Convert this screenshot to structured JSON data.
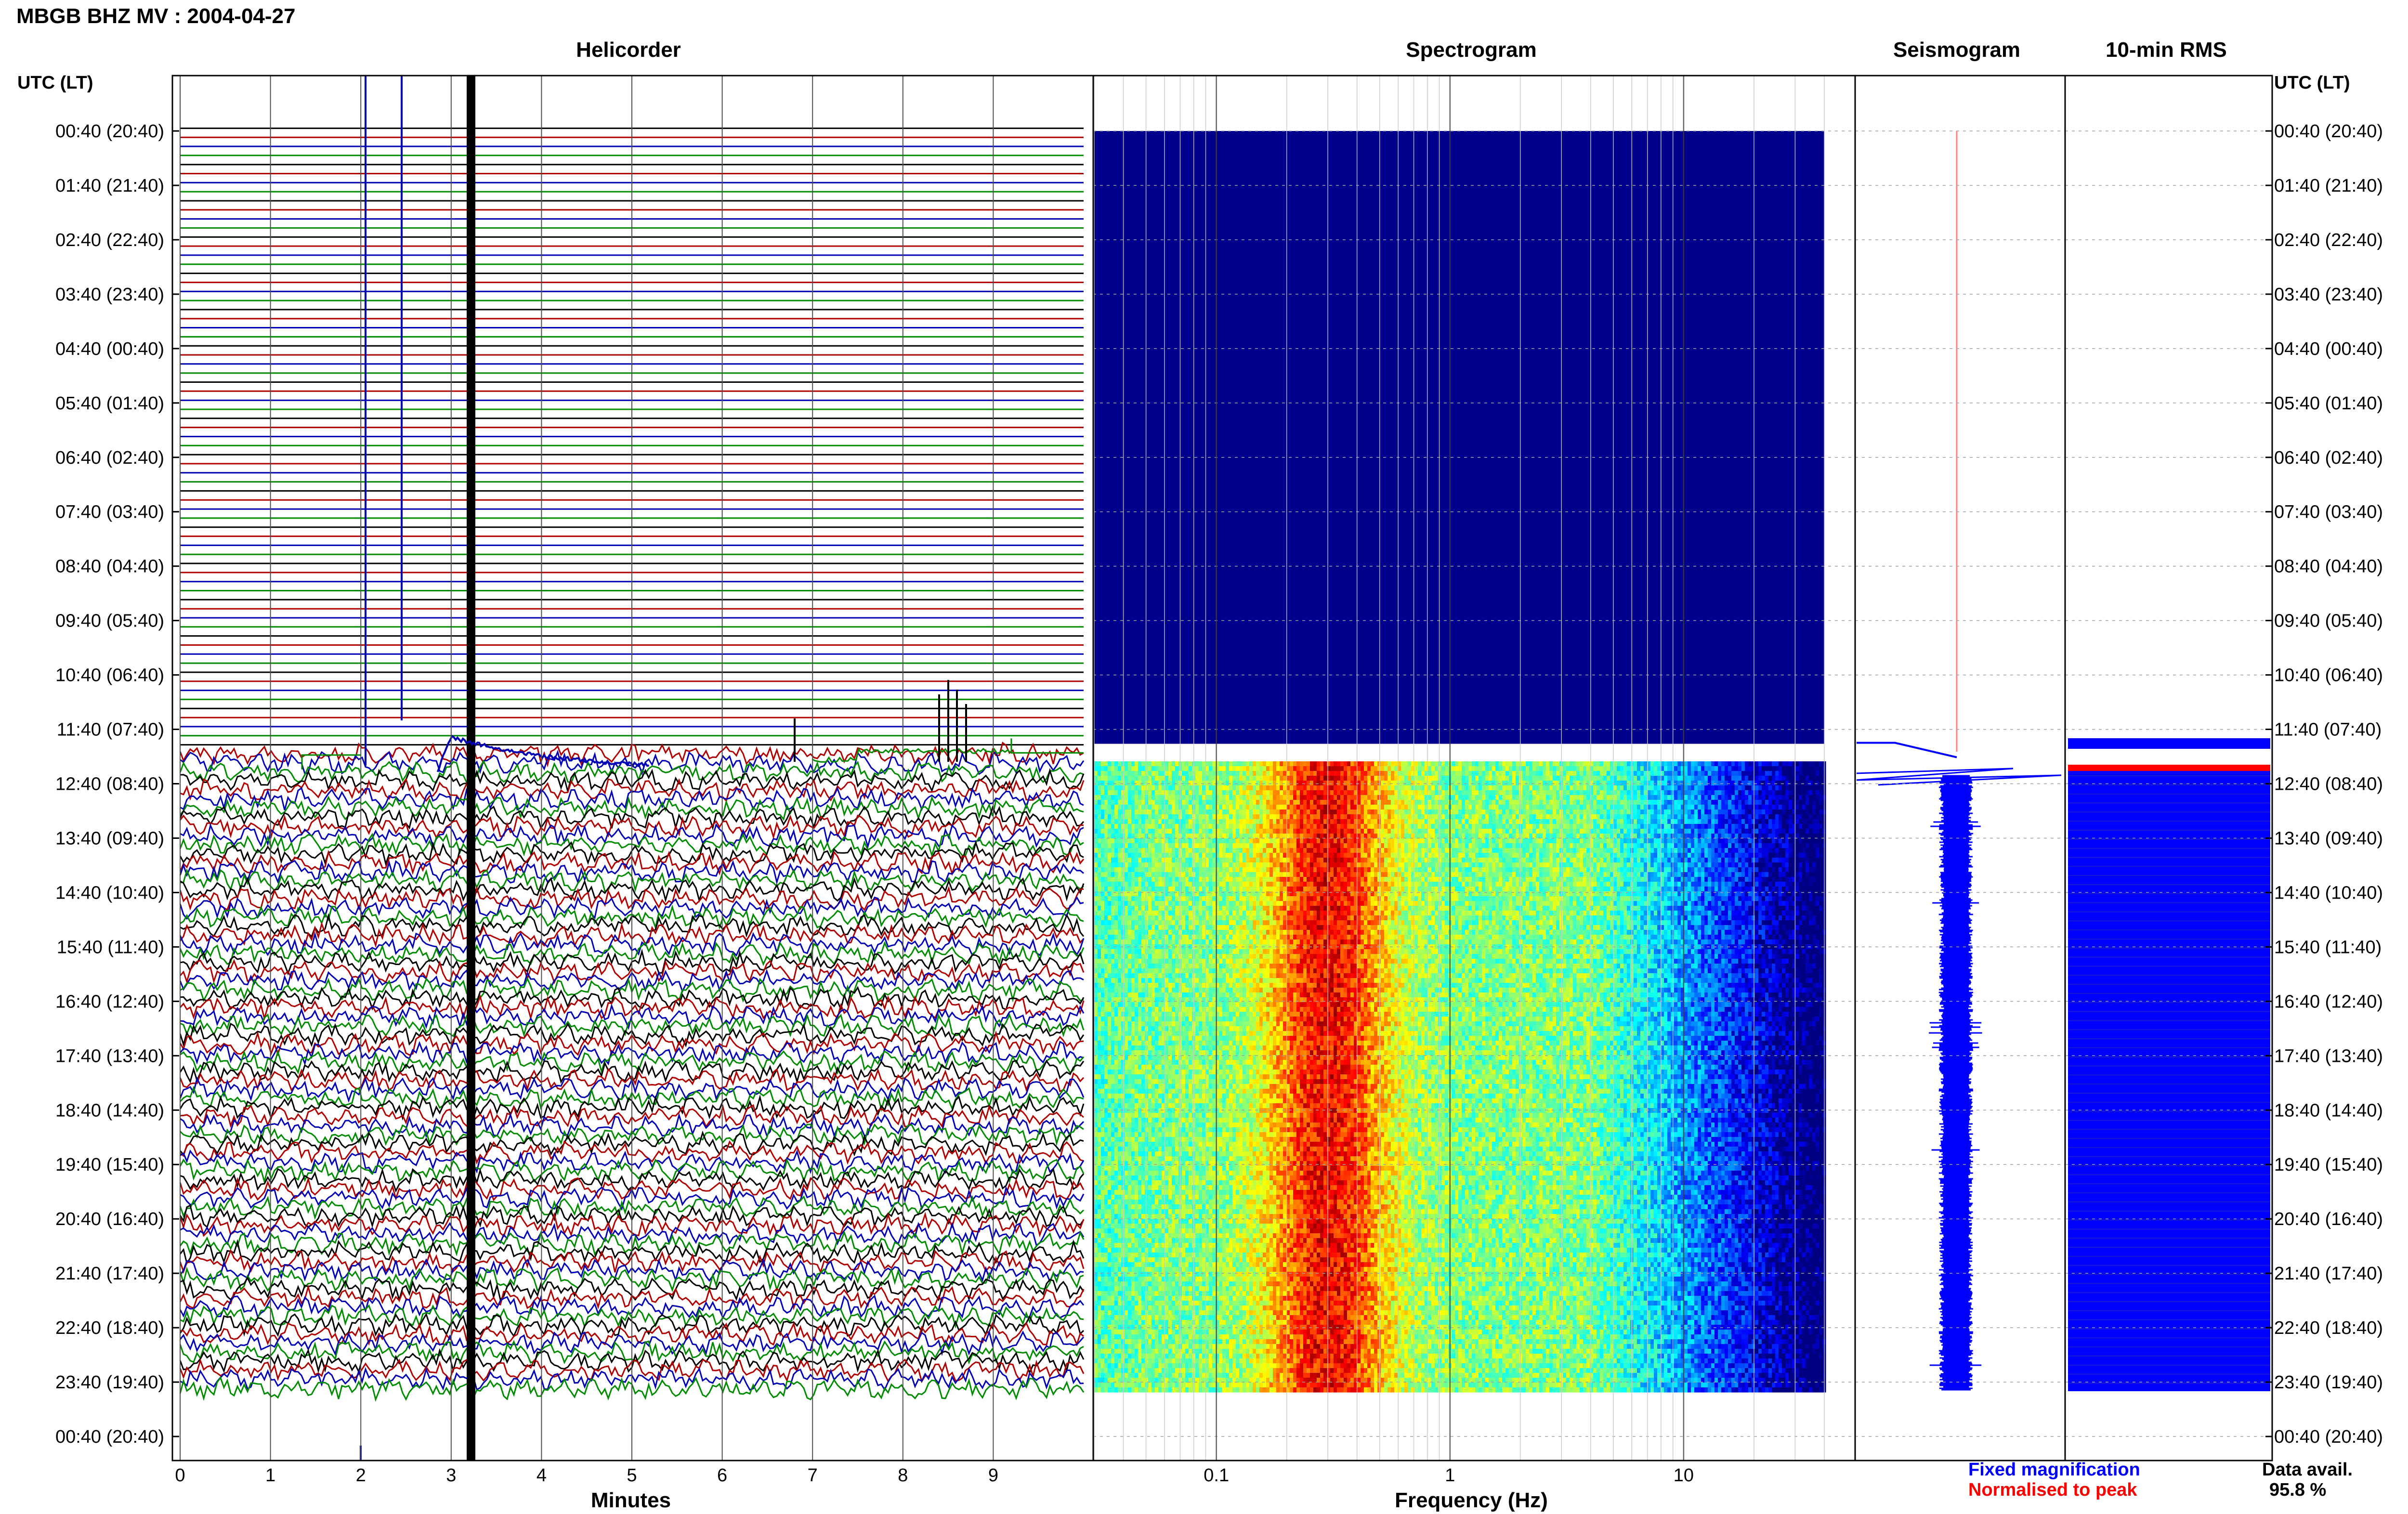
{
  "header": {
    "station_title": "MBGB BHZ MV : 2004-04-27",
    "utc_lt_label": "UTC (LT)"
  },
  "panels": {
    "helicorder_title": "Helicorder",
    "spectrogram_title": "Spectrogram",
    "seismogram_title": "Seismogram",
    "rms_title": "10-min RMS"
  },
  "time_labels": [
    "00:40 (20:40)",
    "01:40 (21:40)",
    "02:40 (22:40)",
    "03:40 (23:40)",
    "04:40 (00:40)",
    "05:40 (01:40)",
    "06:40 (02:40)",
    "07:40 (03:40)",
    "08:40 (04:40)",
    "09:40 (05:40)",
    "10:40 (06:40)",
    "11:40 (07:40)",
    "12:40 (08:40)",
    "13:40 (09:40)",
    "14:40 (10:40)",
    "15:40 (11:40)",
    "16:40 (12:40)",
    "17:40 (13:40)",
    "18:40 (14:40)",
    "19:40 (15:40)",
    "20:40 (16:40)",
    "21:40 (17:40)",
    "22:40 (18:40)",
    "23:40 (19:40)",
    "00:40 (20:40)"
  ],
  "legend": {
    "fixed": "Fixed magnification",
    "normalised": "Normalised to peak",
    "fixed_color": "#0000ff",
    "normalised_color": "#ff0000"
  },
  "availability": {
    "label": "Data avail.",
    "value": "95.8 %"
  },
  "colors": {
    "trace_cycle": [
      "#000000",
      "#b00000",
      "#0000b4",
      "#008c00"
    ],
    "spectrogram_low": "#00008c",
    "spectrogram_high": "#ff5a00"
  },
  "chart_data": [
    {
      "type": "line",
      "title": "Helicorder",
      "xlabel": "Minutes",
      "ylabel": "UTC (LT)",
      "x_ticks": [
        "0",
        "1",
        "2",
        "3",
        "4",
        "5",
        "6",
        "7",
        "8",
        "9"
      ],
      "xlim": [
        0,
        10
      ],
      "rows_per_hour": 6,
      "row_minutes": 10,
      "data_start_utc": "12:10",
      "data_end_utc": "23:50",
      "notes": [
        "flat traces 00:40-12:00",
        "large transient near minute 3.2"
      ]
    },
    {
      "type": "heatmap",
      "title": "Spectrogram",
      "xlabel": "Frequency (Hz)",
      "x_scale": "log",
      "x_ticks": [
        "0.1",
        "1",
        "10"
      ],
      "xlim": [
        0.03,
        40
      ],
      "peak_band_hz": [
        0.2,
        0.45
      ],
      "data_start_utc": "12:10",
      "data_end_utc": "23:50"
    },
    {
      "type": "line",
      "title": "Seismogram",
      "data_start_utc": "12:10",
      "data_end_utc": "23:50"
    },
    {
      "type": "bar",
      "title": "10-min RMS",
      "data_start_utc": "12:10",
      "data_end_utc": "23:50"
    }
  ]
}
